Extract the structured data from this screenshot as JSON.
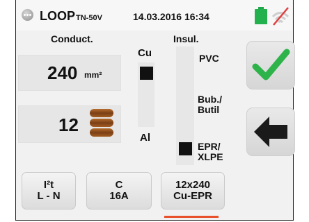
{
  "header": {
    "title": "LOOP",
    "title_sub": "TN-50V",
    "datetime": "14.03.2016 16:34",
    "battery_color": "#22b14c",
    "battery_icon": "battery-icon",
    "signal_icon": "wireless-off-icon",
    "menu_icon": "menu-icon"
  },
  "conductor": {
    "label": "Conduct.",
    "section_value": "240",
    "section_unit": "mm²",
    "count_value": "12",
    "cable_icon": "cable-bundle-icon"
  },
  "material": {
    "top": "Cu",
    "bottom": "Al",
    "selected": "Cu"
  },
  "insulation": {
    "label": "Insul.",
    "options": [
      "PVC",
      "Bub./\nButil",
      "EPR/\nXLPE"
    ],
    "selected": "EPR/XLPE"
  },
  "buttons": {
    "confirm_icon": "checkmark-icon",
    "back_icon": "back-arrow-icon",
    "confirm_color": "#2db34a"
  },
  "tabs": [
    {
      "line1": "I²t",
      "line2": "L - N"
    },
    {
      "line1": "C",
      "line2": "16A"
    },
    {
      "line1": "12x240",
      "line2": "Cu-EPR"
    }
  ],
  "active_tab": 2,
  "accent_color": "#e8502a"
}
